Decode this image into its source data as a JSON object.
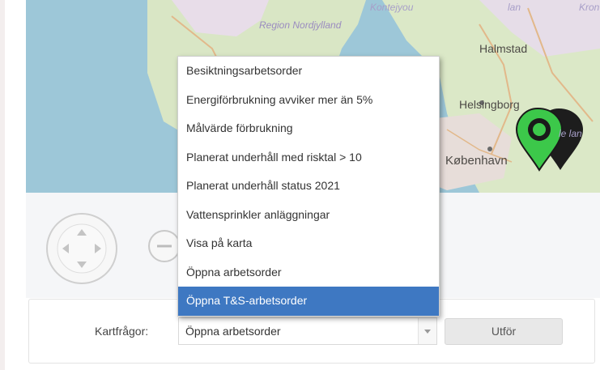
{
  "map": {
    "labels": {
      "region": "Region Nordjylland",
      "top_faint": "Kontejyou",
      "top_right_faint": "lan",
      "top_right_corner": "Kron",
      "halmstad": "Halmstad",
      "helsingborg": "Helsingborg",
      "side_faint": "le lan",
      "kobenhavn": "København"
    },
    "marker_color": "#3cc84a"
  },
  "controls": {
    "pan_icon": "pan-arrows-icon",
    "zoom_out_icon": "zoom-out-icon"
  },
  "dropdown": {
    "items": [
      "Besiktningsarbetsorder",
      "Energiförbrukning avviker mer än 5%",
      "Målvärde förbrukning",
      "Planerat underhåll med risktal > 10",
      "Planerat underhåll status 2021",
      "Vattensprinkler anläggningar",
      "Visa på karta",
      "Öppna arbetsorder",
      "Öppna T&S-arbetsorder"
    ],
    "highlighted": "Öppna T&S-arbetsorder",
    "highlight_color": "#3e78c2"
  },
  "query_bar": {
    "label": "Kartfrågor:",
    "selected_value": "Öppna arbetsorder",
    "run_button": "Utför"
  }
}
